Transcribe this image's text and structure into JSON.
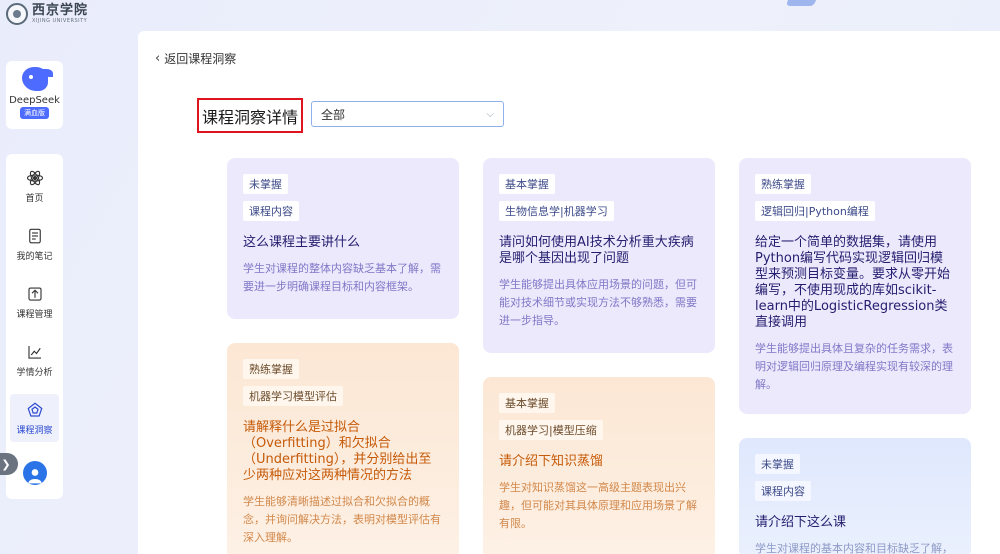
{
  "logo": {
    "cn": "西京学院",
    "en": "XIJING UNIVERSITY"
  },
  "deepseek": {
    "name": "DeepSeek",
    "badge": "满血版"
  },
  "nav": [
    {
      "label": "首页",
      "icon": "atom-icon"
    },
    {
      "label": "我的笔记",
      "icon": "notes-icon"
    },
    {
      "label": "课程管理",
      "icon": "upload-icon"
    },
    {
      "label": "学情分析",
      "icon": "chart-icon"
    },
    {
      "label": "课程洞察",
      "icon": "pentagon-icon"
    }
  ],
  "back": {
    "label": "返回课程洞察"
  },
  "page": {
    "title": "课程洞察详情"
  },
  "filter": {
    "value": "全部"
  },
  "cards": [
    {
      "level": "未掌握",
      "topic": "课程内容",
      "question": "这么课程主要讲什么",
      "desc": "学生对课程的整体内容缺乏基本了解，需要进一步明确课程目标和内容框架。"
    },
    {
      "level": "熟练掌握",
      "topic": "机器学习模型评估",
      "question": "请解释什么是过拟合（Overfitting）和欠拟合（Underfitting），并分别给出至少两种应对这两种情况的方法",
      "desc": "学生能够清晰描述过拟合和欠拟合的概念，并询问解决方法，表明对模型评估有深入理解。"
    },
    {
      "level": "基本掌握",
      "topic": "生物信息学|机器学习",
      "question": "请问如何使用AI技术分析重大疾病是哪个基因出现了问题",
      "desc": "学生能够提出具体应用场景的问题，但可能对技术细节或实现方法不够熟悉，需要进一步指导。"
    },
    {
      "level": "基本掌握",
      "topic": "机器学习|模型压缩",
      "question": "请介绍下知识蒸馏",
      "desc": "学生对知识蒸馏这一高级主题表现出兴趣，但可能对其具体原理和应用场景了解有限。"
    },
    {
      "level": "熟练掌握",
      "topic": "逻辑回归|Python编程",
      "question": "给定一个简单的数据集，请使用Python编写代码实现逻辑回归模型来预测目标变量。要求从零开始编写，不使用现成的库如scikit-learn中的LogisticRegression类直接调用",
      "desc": "学生能够提出具体且复杂的任务需求，表明对逻辑回归原理及编程实现有较深的理解。"
    },
    {
      "level": "未掌握",
      "topic": "课程内容",
      "question": "请介绍下这么课",
      "desc": "学生对课程的基本内容和目标缺乏了解，需要进一步的课程介绍。"
    }
  ]
}
